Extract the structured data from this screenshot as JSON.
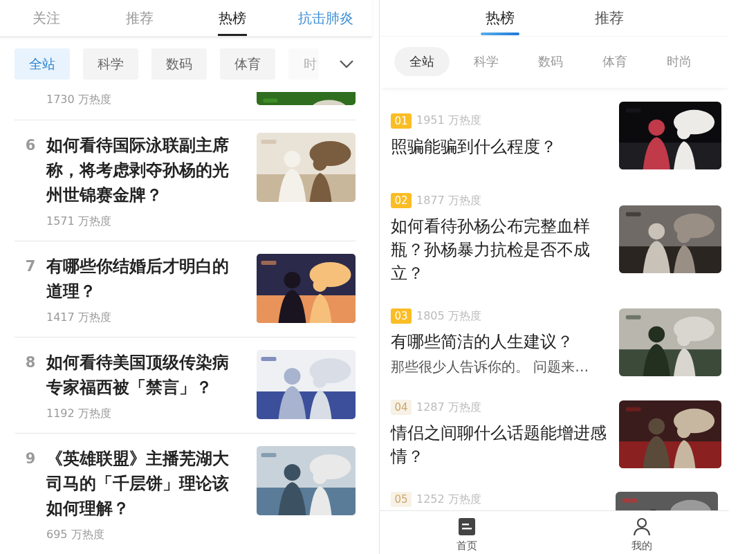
{
  "left": {
    "tabs": [
      {
        "label": "关注",
        "selected": false,
        "kind": "normal"
      },
      {
        "label": "推荐",
        "selected": false,
        "kind": "normal"
      },
      {
        "label": "热榜",
        "selected": true,
        "kind": "normal"
      },
      {
        "label": "抗击肺炎",
        "selected": false,
        "kind": "campaign"
      }
    ],
    "categories": [
      {
        "label": "全站",
        "selected": true,
        "kind": "chip"
      },
      {
        "label": "科学",
        "selected": false,
        "kind": "chip"
      },
      {
        "label": "数码",
        "selected": false,
        "kind": "chip"
      },
      {
        "label": "体育",
        "selected": false,
        "kind": "chip"
      },
      {
        "label": "时",
        "selected": false,
        "kind": "cut"
      }
    ],
    "items": [
      {
        "heat": "1730 万热度",
        "kind": "cut"
      },
      {
        "rank": "6",
        "title": "如何看待国际泳联副主席称，将考虑剥夺孙杨的光州世锦赛金牌？",
        "heat": "1571 万热度",
        "kind": "full"
      },
      {
        "rank": "7",
        "title": "有哪些你结婚后才明白的道理？",
        "heat": "1417 万热度",
        "kind": "full"
      },
      {
        "rank": "8",
        "title": "如何看待美国顶级传染病专家福西被「禁言」？",
        "heat": "1192 万热度",
        "kind": "full"
      },
      {
        "rank": "9",
        "title": "《英雄联盟》主播芜湖大司马的「千层饼」理论该如何理解？",
        "heat": "695 万热度",
        "kind": "full"
      }
    ]
  },
  "right": {
    "tabs": [
      {
        "label": "热榜",
        "selected": true
      },
      {
        "label": "推荐",
        "selected": false
      }
    ],
    "categories": [
      {
        "label": "全站",
        "selected": true
      },
      {
        "label": "科学",
        "selected": false
      },
      {
        "label": "数码",
        "selected": false
      },
      {
        "label": "体育",
        "selected": false
      },
      {
        "label": "时尚",
        "selected": false
      }
    ],
    "items": [
      {
        "rank": "01",
        "kind": "top",
        "heat": "1951 万热度",
        "title": "照骗能骗到什么程度？"
      },
      {
        "rank": "02",
        "kind": "top",
        "heat": "1877 万热度",
        "title": "如何看待孙杨公布完整血样瓶？孙杨暴力抗检是否不成立？"
      },
      {
        "rank": "03",
        "kind": "top",
        "heat": "1805 万热度",
        "title": "有哪些简洁的人生建议？",
        "excerpt": "那些很少人告诉你的。 问题来…"
      },
      {
        "rank": "04",
        "kind": "normal",
        "heat": "1287 万热度",
        "title": "情侣之间聊什么话题能增进感情？"
      },
      {
        "rank": "05",
        "kind": "normal",
        "heat": "1252 万热度"
      }
    ],
    "nav": [
      {
        "label": "首页",
        "kind": "home"
      },
      {
        "label": "我的",
        "kind": "profile"
      }
    ]
  }
}
